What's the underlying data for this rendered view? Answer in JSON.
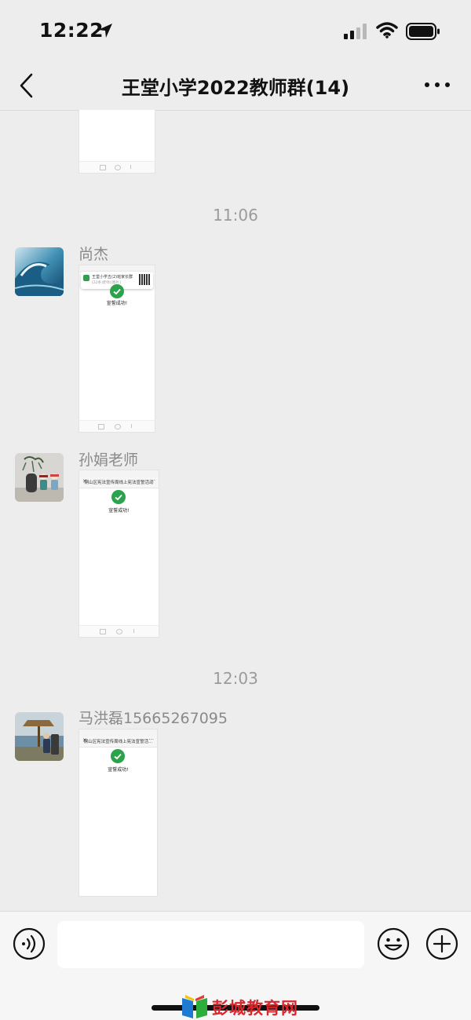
{
  "status_bar": {
    "time": "12:22"
  },
  "header": {
    "title": "王堂小学2022教师群(14)"
  },
  "messages": [
    {
      "type": "timestamp",
      "text": "11:06"
    },
    {
      "sender": "尚杰",
      "screenshot": {
        "notification_title": "王堂小学五(2)班家长群",
        "notification_subtitle": "[22条]老师:[图片]",
        "success_text": "宣誓成功!"
      }
    },
    {
      "sender": "孙娟老师",
      "screenshot": {
        "page_title": "铜山区宪法宣传周线上宪法宣誓活动",
        "success_text": "宣誓成功!"
      }
    },
    {
      "type": "timestamp",
      "text": "12:03"
    },
    {
      "sender": "马洪磊15665267095",
      "screenshot": {
        "page_title": "铜山区宪法宣传周线上宪法宣誓活...",
        "success_text": "宣誓成功!"
      }
    }
  ],
  "input": {
    "placeholder": ""
  },
  "watermark": {
    "text": "彭城教育网"
  },
  "colors": {
    "background": "#ededed",
    "success_green": "#2ba24c",
    "watermark_red": "#d8282e"
  }
}
